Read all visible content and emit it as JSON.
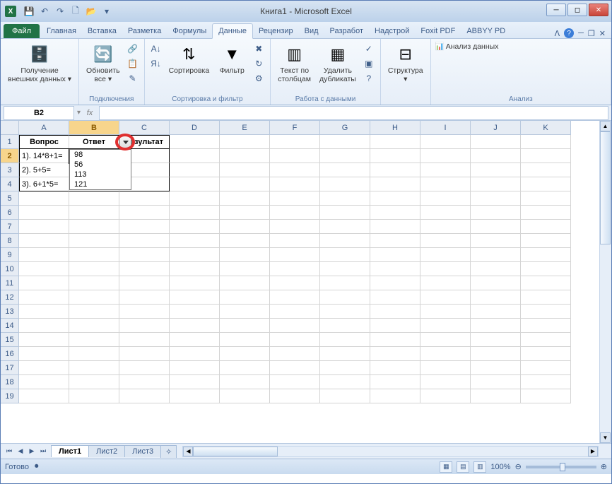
{
  "title": "Книга1 - Microsoft Excel",
  "qat": [
    "save-icon",
    "undo-icon",
    "redo-icon",
    "new-icon",
    "open-icon",
    "print-icon"
  ],
  "file_tab": "Файл",
  "tabs": [
    "Главная",
    "Вставка",
    "Разметка",
    "Формулы",
    "Данные",
    "Рецензир",
    "Вид",
    "Разработ",
    "Надстрой",
    "Foxit PDF",
    "ABBYY PD"
  ],
  "active_tab": "Данные",
  "ribbon": {
    "g1": {
      "btn": "Получение\nвнешних данных ▾",
      "label": ""
    },
    "g2": {
      "btn": "Обновить\nвсе ▾",
      "label": "Подключения",
      "s1": "Подключения",
      "s2": "Свойства",
      "s3": "Изменить связи"
    },
    "g3": {
      "sort_small": "А▾Я",
      "sort_btn": "Сортировка",
      "filter_btn": "Фильтр",
      "adv1": "Очистить",
      "adv2": "Повторить",
      "adv3": "Дополнительно",
      "label": "Сортировка и фильтр"
    },
    "g4": {
      "b1": "Текст по\nстолбцам",
      "b2": "Удалить\nдубликаты",
      "label": "Работа с данными"
    },
    "g5": {
      "btn": "Структура\n▾",
      "label": ""
    },
    "g6": {
      "btn": "Анализ данных",
      "label": "Анализ"
    }
  },
  "name_box": "B2",
  "fx_label": "fx",
  "formula_value": "",
  "columns": [
    "A",
    "B",
    "C",
    "D",
    "E",
    "F",
    "G",
    "H",
    "I",
    "J",
    "K"
  ],
  "selected_col": "B",
  "rows": [
    1,
    2,
    3,
    4,
    5,
    6,
    7,
    8,
    9,
    10,
    11,
    12,
    13,
    14,
    15,
    16,
    17,
    18,
    19
  ],
  "selected_row": 2,
  "table": {
    "headers": [
      "Вопрос",
      "Ответ",
      "Результат"
    ],
    "data": [
      {
        "q": "1). 14*8+1=",
        "a": "",
        "r": ""
      },
      {
        "q": "2). 5+5=",
        "a": "",
        "r": ""
      },
      {
        "q": "3). 6+1*5=",
        "a": "",
        "r": ""
      }
    ]
  },
  "dropdown_options": [
    "98",
    "56",
    "113",
    "121"
  ],
  "sheets": [
    "Лист1",
    "Лист2",
    "Лист3"
  ],
  "active_sheet": "Лист1",
  "status": "Готово",
  "zoom": "100%"
}
